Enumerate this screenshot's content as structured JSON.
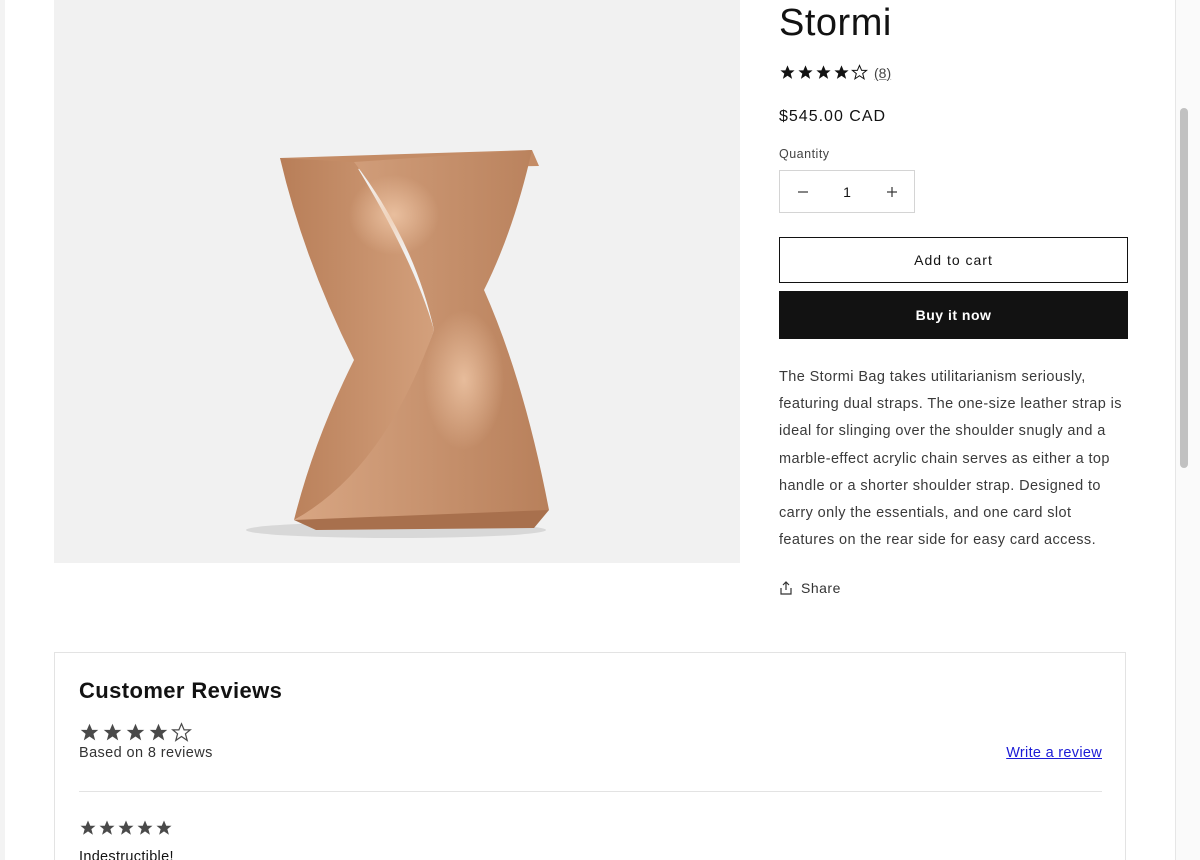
{
  "product": {
    "title": "Stormi",
    "rating": {
      "value": 4,
      "max": 5,
      "count_label": "(8)"
    },
    "price": "$545.00 CAD",
    "quantity": {
      "label": "Quantity",
      "value": "1",
      "decrease_icon": "minus-icon",
      "increase_icon": "plus-icon"
    },
    "add_to_cart_label": "Add to cart",
    "buy_now_label": "Buy it now",
    "description": "The Stormi Bag takes utilitarianism seriously, featuring dual straps. The one-size leather strap is ideal for slinging over the shoulder snugly and a marble-effect acrylic chain serves as either a top handle or a shorter shoulder strap. Designed to carry only the essentials, and one card slot features on the rear side for easy card access.",
    "share_label": "Share",
    "share_icon": "share-icon"
  },
  "reviews": {
    "title": "Customer Reviews",
    "average_rating": 4,
    "based_on": "Based on 8 reviews",
    "write_review_label": "Write a review",
    "items": [
      {
        "rating": 5,
        "title": "Indestructible!"
      }
    ]
  },
  "colors": {
    "text": "#121212",
    "button_dark": "#121212",
    "link": "#1b1bd6",
    "bag": "#c9906a",
    "image_bg": "#f1f1f1"
  }
}
